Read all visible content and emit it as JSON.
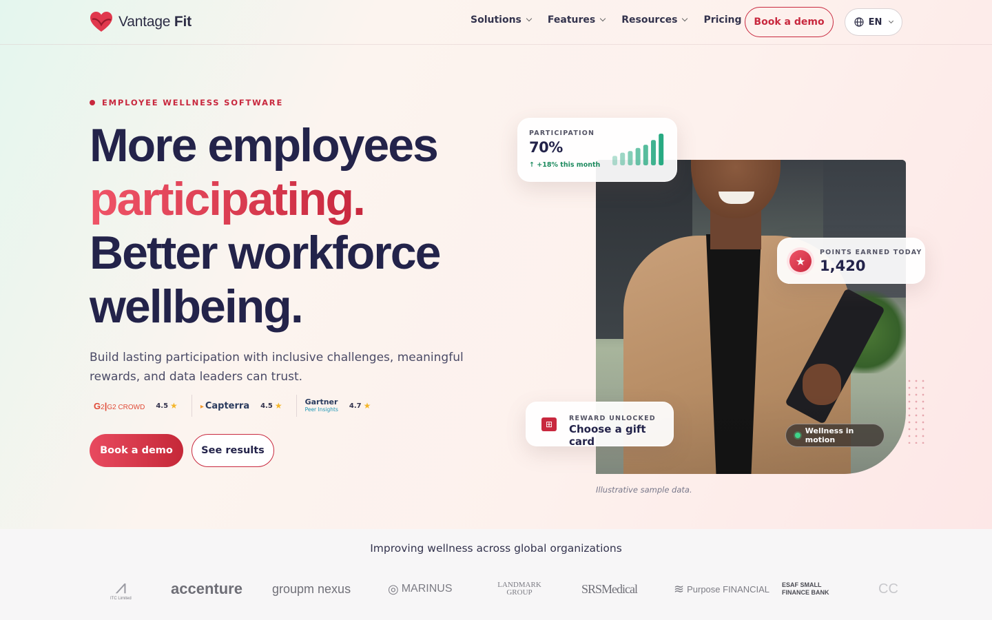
{
  "brand": {
    "name_light": "Vantage",
    "name_bold": "Fit",
    "accent_color": "#c8283e",
    "accent_light": "#ef5467"
  },
  "nav": {
    "items": [
      {
        "label": "Solutions",
        "has_dropdown": true
      },
      {
        "label": "Features",
        "has_dropdown": true
      },
      {
        "label": "Resources",
        "has_dropdown": true
      },
      {
        "label": "Pricing",
        "has_dropdown": false
      }
    ],
    "cta_label": "Book a demo",
    "language": "EN"
  },
  "hero": {
    "eyebrow": "EMPLOYEE WELLNESS SOFTWARE",
    "headline_1": "More employees",
    "headline_accent": "participating.",
    "headline_2": "Better workforce",
    "headline_3": "wellbeing.",
    "subcopy": "Build lasting participation with inclusive challenges, meaningful rewards, and data leaders can trust.",
    "ratings": [
      {
        "source": "G2 CROWD",
        "score": "4.5"
      },
      {
        "source": "Capterra",
        "score": "4.5"
      },
      {
        "source": "Gartner",
        "sub": "Peer Insights",
        "score": "4.7"
      }
    ],
    "primary_cta": "Book a demo",
    "secondary_cta": "See results"
  },
  "cards": {
    "participation": {
      "label": "PARTICIPATION",
      "value": "70%",
      "delta": "+18% this month",
      "bar_levels": [
        0.3,
        0.4,
        0.45,
        0.55,
        0.65,
        0.8,
        1.0
      ]
    },
    "points": {
      "label": "POINTS EARNED TODAY",
      "value": "1,420"
    },
    "reward": {
      "label": "REWARD UNLOCKED",
      "value": "Choose a gift card"
    },
    "motion_badge": "Wellness in motion",
    "caption": "Illustrative sample data."
  },
  "logos": {
    "title": "Improving wellness across global organizations",
    "orgs": [
      "ITC Limited",
      "accenture",
      "groupm nexus",
      "MARINUS",
      "LANDMARK GROUP",
      "SRSMedical",
      "Purpose FINANCIAL",
      "ESAF SMALL FINANCE BANK",
      "CC"
    ]
  }
}
